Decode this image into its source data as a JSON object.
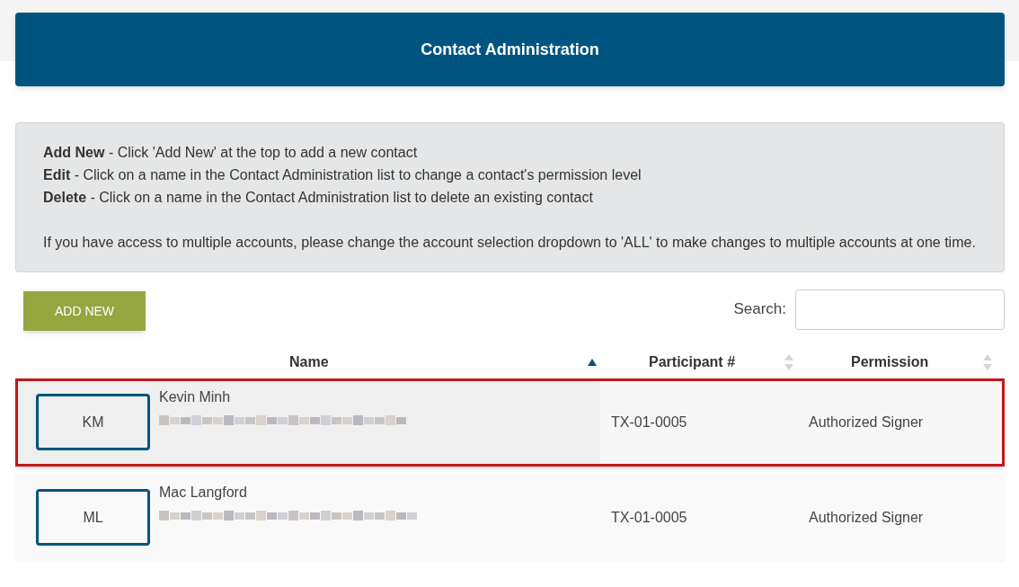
{
  "header": {
    "title": "Contact Administration"
  },
  "instructions": {
    "lines": [
      "**Add New** - Click 'Add New' at the top to add a new contact",
      "**Edit** - Click on a name in the Contact Administration list to change a contact's permission level",
      "**Delete** - Click on a name in the Contact Administration list to delete an existing contact"
    ],
    "note": "If you have access to multiple accounts, please change the account selection dropdown to 'ALL' to make changes to multiple accounts at one time."
  },
  "add_button": "ADD NEW",
  "search": {
    "label": "Search:"
  },
  "table": {
    "columns": [
      {
        "label": "Name",
        "sorted": true
      },
      {
        "label": "Participant #",
        "sorted": false
      },
      {
        "label": "Permission",
        "sorted": false
      }
    ],
    "rows": [
      {
        "initials": "KM",
        "name": "Kevin Minh",
        "participant": "TX-01-0005",
        "permission": "Authorized Signer",
        "selected": true
      },
      {
        "initials": "ML",
        "name": "Mac Langford",
        "participant": "TX-01-0005",
        "permission": "Authorized Signer",
        "selected": false
      }
    ]
  }
}
